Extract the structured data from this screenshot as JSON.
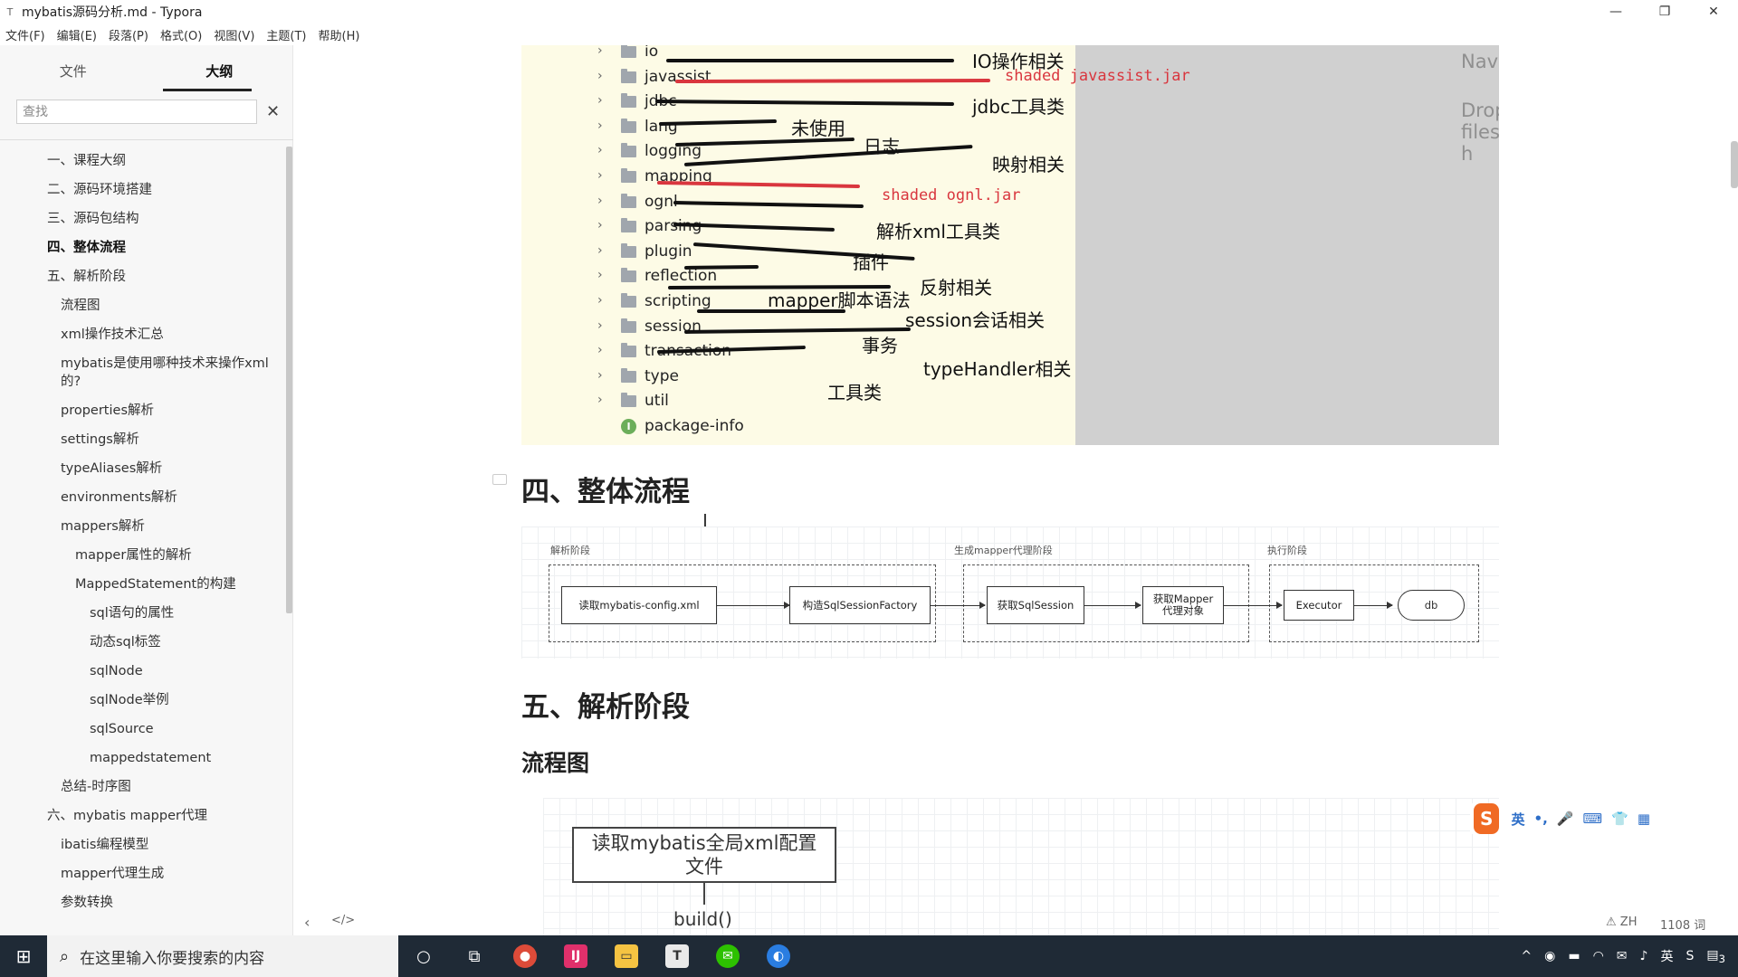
{
  "window": {
    "title": "mybatis源码分析.md - Typora",
    "controls": {
      "minimize": "—",
      "maximize": "❐",
      "close": "✕"
    }
  },
  "menu": [
    "文件(F)",
    "编辑(E)",
    "段落(P)",
    "格式(O)",
    "视图(V)",
    "主题(T)",
    "帮助(H)"
  ],
  "sidebar": {
    "tabs": [
      "文件",
      "大纲"
    ],
    "active_tab": "大纲",
    "search_placeholder": "查找",
    "search_clear": "✕",
    "outline": [
      {
        "label": "一、课程大纲",
        "level": 2
      },
      {
        "label": "二、源码环境搭建",
        "level": 2
      },
      {
        "label": "三、源码包结构",
        "level": 2
      },
      {
        "label": "四、整体流程",
        "level": 2,
        "active": true
      },
      {
        "label": "五、解析阶段",
        "level": 2
      },
      {
        "label": "流程图",
        "level": 3
      },
      {
        "label": "xml操作技术汇总",
        "level": 3
      },
      {
        "label": "mybatis是使用哪种技术来操作xml的?",
        "level": 3
      },
      {
        "label": "properties解析",
        "level": 3
      },
      {
        "label": "settings解析",
        "level": 3
      },
      {
        "label": "typeAliases解析",
        "level": 3
      },
      {
        "label": "environments解析",
        "level": 3
      },
      {
        "label": "mappers解析",
        "level": 3
      },
      {
        "label": "mapper属性的解析",
        "level": 4
      },
      {
        "label": "MappedStatement的构建",
        "level": 4
      },
      {
        "label": "sql语句的属性",
        "level": 5
      },
      {
        "label": "动态sql标签",
        "level": 5
      },
      {
        "label": "sqlNode",
        "level": 5
      },
      {
        "label": "sqlNode举例",
        "level": 5
      },
      {
        "label": "sqlSource",
        "level": 5
      },
      {
        "label": "mappedstatement",
        "level": 5
      },
      {
        "label": "总结-时序图",
        "level": 3
      },
      {
        "label": "六、mybatis mapper代理",
        "level": 2
      },
      {
        "label": "ibatis编程模型",
        "level": 3
      },
      {
        "label": "mapper代理生成",
        "level": 3
      },
      {
        "label": "参数转换",
        "level": 3
      }
    ]
  },
  "package_image": {
    "gray_text": [
      "Navigation",
      "Drop files h"
    ],
    "packages": [
      "io",
      "javassist",
      "jdbc",
      "lang",
      "logging",
      "mapping",
      "ognl",
      "parsing",
      "plugin",
      "reflection",
      "scripting",
      "session",
      "transaction",
      "type",
      "util"
    ],
    "last_item": "package-info",
    "info_icon": "I",
    "annotations": [
      "IO操作相关",
      "shaded javassist.jar",
      "jdbc工具类",
      "未使用",
      "日志",
      "映射相关",
      "shaded ognl.jar",
      "解析xml工具类",
      "插件",
      "反射相关",
      "mapper脚本语法",
      "session会话相关",
      "事务",
      "typeHandler相关",
      "工具类"
    ]
  },
  "doc": {
    "h_flow": "四、整体流程",
    "h_parse": "五、解析阶段",
    "h_flowchart": "流程图"
  },
  "flow_diagram": {
    "stages": [
      "解析阶段",
      "生成mapper代理阶段",
      "执行阶段"
    ],
    "nodes": {
      "read_config": "读取mybatis-config.xml",
      "build_factory": "构造SqlSessionFactory",
      "get_session": "获取SqlSession",
      "get_mapper_1": "获取Mapper",
      "get_mapper_2": "代理对象",
      "executor": "Executor",
      "db": "db"
    }
  },
  "flowchart2": {
    "box_line1": "读取mybatis全局xml配置",
    "box_line2": "文件",
    "build_label": "build()"
  },
  "ime": {
    "logo": "S",
    "lang": "英",
    "punct": "•,",
    "mic": "🎤",
    "kbd": "⌨",
    "skin": "👕",
    "grid": "▦"
  },
  "footer": {
    "nav_left": "‹",
    "source_toggle": "</>",
    "lang": "⚠ ZH",
    "words": "1108 词"
  },
  "taskbar": {
    "search_placeholder": "在这里输入你要搜索的内容",
    "tray": {
      "ime": "英",
      "notif": "3"
    }
  }
}
